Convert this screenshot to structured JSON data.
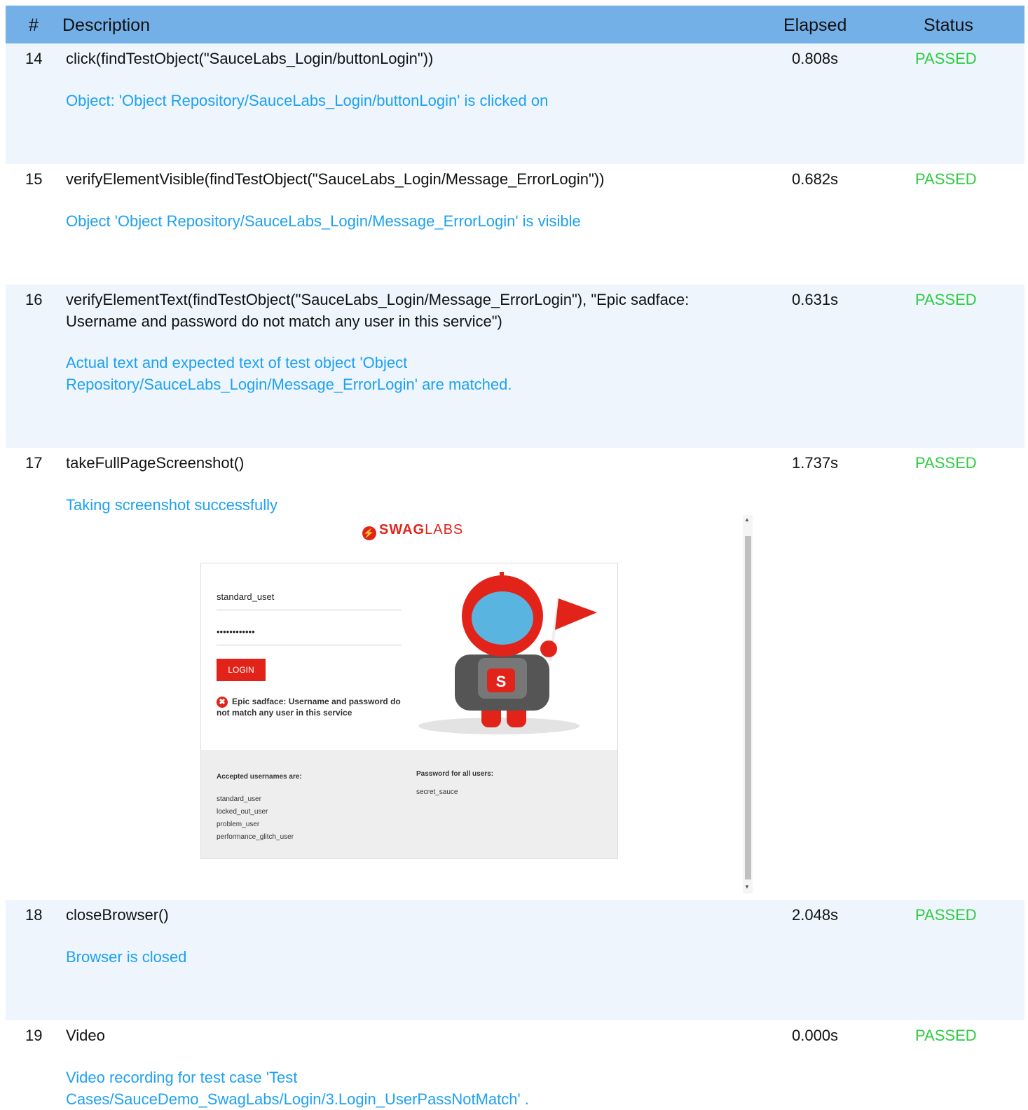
{
  "header": {
    "num": "#",
    "description": "Description",
    "elapsed": "Elapsed",
    "status": "Status"
  },
  "rows": [
    {
      "num": "14",
      "description": "click(findTestObject(\"SauceLabs_Login/buttonLogin\"))",
      "elapsed": "0.808s",
      "status": "PASSED",
      "message": "Object: 'Object Repository/SauceLabs_Login/buttonLogin' is clicked on"
    },
    {
      "num": "15",
      "description": "verifyElementVisible(findTestObject(\"SauceLabs_Login/Message_ErrorLogin\"))",
      "elapsed": "0.682s",
      "status": "PASSED",
      "message": "Object 'Object Repository/SauceLabs_Login/Message_ErrorLogin' is visible"
    },
    {
      "num": "16",
      "description": "verifyElementText(findTestObject(\"SauceLabs_Login/Message_ErrorLogin\"), \"Epic sadface: Username and password do not match any user in this service\")",
      "elapsed": "0.631s",
      "status": "PASSED",
      "message": "Actual text and expected text of test object 'Object Repository/SauceLabs_Login/Message_ErrorLogin' are matched."
    },
    {
      "num": "17",
      "description": "takeFullPageScreenshot()",
      "elapsed": "1.737s",
      "status": "PASSED",
      "message": "Taking screenshot successfully"
    },
    {
      "num": "18",
      "description": "closeBrowser()",
      "elapsed": "2.048s",
      "status": "PASSED",
      "message": "Browser is closed"
    },
    {
      "num": "19",
      "description": "Video",
      "elapsed": "0.000s",
      "status": "PASSED",
      "message": "Video recording for test case 'Test Cases/SauceDemo_SwagLabs/Login/3.Login_UserPassNotMatch' ."
    }
  ],
  "screenshot": {
    "brand_bold": "SWAG",
    "brand_light": "LABS",
    "username_value": "standard_uset",
    "password_value": "••••••••••••",
    "login_label": "LOGIN",
    "error_text": "Epic sadface: Username and password do not match any user in this service",
    "accepted_heading": "Accepted usernames are:",
    "usernames": [
      "standard_user",
      "locked_out_user",
      "problem_user",
      "performance_glitch_user"
    ],
    "password_heading": "Password for all users:",
    "password_hint": "secret_sauce"
  },
  "colors": {
    "header_bg": "#74b0e8",
    "row_shade": "#eef5fc",
    "message": "#1da1f2",
    "passed": "#2ecc40",
    "brand": "#e2231a"
  }
}
